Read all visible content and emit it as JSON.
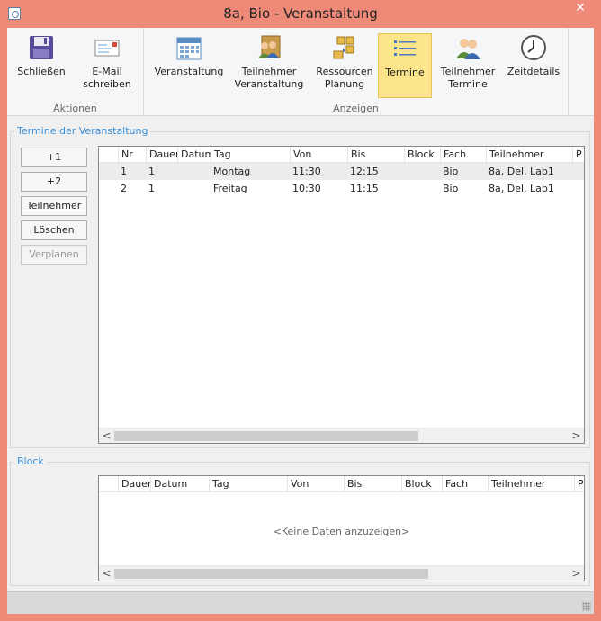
{
  "window": {
    "title": "8a, Bio - Veranstaltung",
    "close": "✕"
  },
  "ribbon": {
    "groups": {
      "aktionen": "Aktionen",
      "anzeigen": "Anzeigen"
    },
    "buttons": {
      "schliessen": "Schließen",
      "email": "E-Mail\nschreiben",
      "veranstaltung": "Veranstaltung",
      "teilnehmer_veranstaltung": "Teilnehmer\nVeranstaltung",
      "ressourcen": "Ressourcen\nPlanung",
      "termine": "Termine",
      "teilnehmer_termine": "Teilnehmer\nTermine",
      "zeitdetails": "Zeitdetails"
    },
    "active": "termine"
  },
  "termine_box": {
    "legend": "Termine der Veranstaltung",
    "buttons": [
      "+1",
      "+2",
      "Teilnehmer",
      "Löschen",
      "Verplanen"
    ],
    "columns": [
      "Nr",
      "Dauer",
      "Datum",
      "Tag",
      "Von",
      "Bis",
      "Block",
      "Fach",
      "Teilnehmer",
      "P"
    ],
    "rows": [
      [
        "1",
        "1",
        "",
        "Montag",
        "11:30",
        "12:15",
        "",
        "Bio",
        "8a, Del, Lab1"
      ],
      [
        "2",
        "1",
        "",
        "Freitag",
        "10:30",
        "11:15",
        "",
        "Bio",
        "8a, Del, Lab1"
      ]
    ]
  },
  "block_box": {
    "legend": "Block",
    "columns": [
      "Dauer",
      "Datum",
      "Tag",
      "Von",
      "Bis",
      "Block",
      "Fach",
      "Teilnehmer",
      "P"
    ],
    "empty_text": "<Keine Daten anzuzeigen>"
  },
  "scroll": {
    "left": "<",
    "right": ">"
  },
  "colors": {
    "accent": "#3b8ed6",
    "active": "#fce48a",
    "chrome": "#f08a78"
  }
}
